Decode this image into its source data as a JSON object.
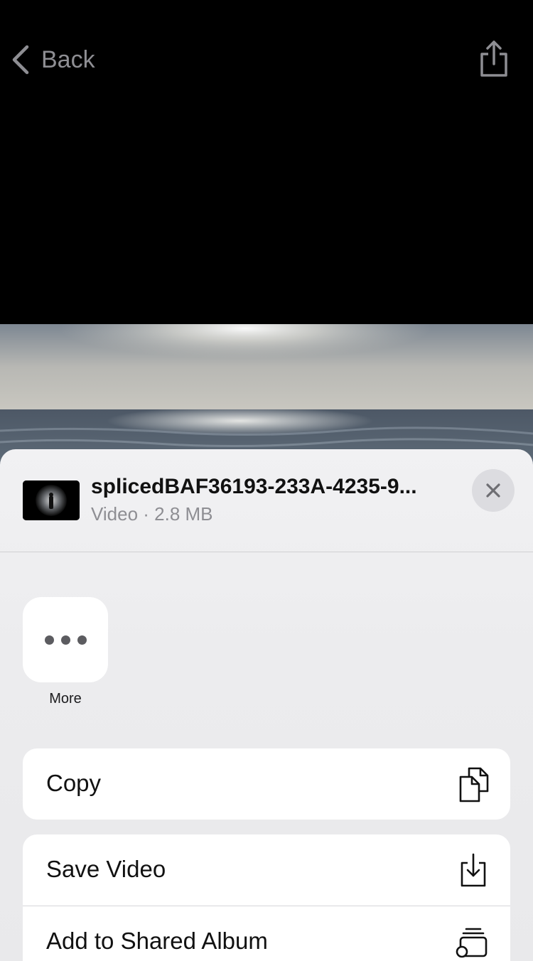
{
  "nav": {
    "back_label": "Back"
  },
  "share_sheet": {
    "file_name": "splicedBAF36193-233A-4235-9...",
    "file_meta": "Video · 2.8 MB",
    "more_label": "More",
    "actions_group1": [
      {
        "label": "Copy",
        "icon": "copy-icon"
      }
    ],
    "actions_group2": [
      {
        "label": "Save Video",
        "icon": "save-to-device-icon"
      },
      {
        "label": "Add to Shared Album",
        "icon": "shared-album-icon"
      }
    ]
  },
  "colors": {
    "sheet_bg": "#ececee",
    "card_bg": "#ffffff",
    "nav_gray": "#8e8e93"
  }
}
